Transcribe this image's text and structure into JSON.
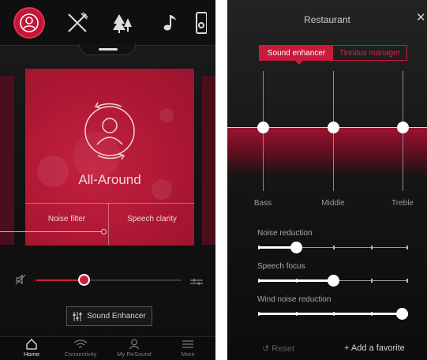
{
  "left_screen": {
    "top_bar": {
      "icons": [
        "profile-icon",
        "fork-knife-icon",
        "tree-icon",
        "music-note-icon",
        "speaker-icon"
      ],
      "accent_color": "#c4163a"
    },
    "program_card": {
      "title": "All-Around",
      "options": [
        {
          "label": "Noise filter"
        },
        {
          "label": "Speech clarity"
        }
      ]
    },
    "volume": {
      "level": 0.33
    },
    "sound_enhancer_button": {
      "label": "Sound Enhancer"
    },
    "bottom_nav": [
      {
        "label": "Home",
        "icon": "home-icon",
        "active": true
      },
      {
        "label": "Connectivity",
        "icon": "wifi-icon",
        "active": false
      },
      {
        "label": "My ReSound",
        "icon": "person-icon",
        "active": false
      },
      {
        "label": "More",
        "icon": "menu-icon",
        "active": false
      }
    ]
  },
  "right_screen": {
    "title": "Restaurant",
    "close_label": "✕",
    "tabs": [
      {
        "label": "Sound enhancer",
        "selected": true
      },
      {
        "label": "Tinnitus manager",
        "selected": false
      }
    ],
    "equalizer": [
      {
        "label": "Bass",
        "value": 0
      },
      {
        "label": "Middle",
        "value": 0
      },
      {
        "label": "Treble",
        "value": 0
      }
    ],
    "sliders": [
      {
        "label": "Noise reduction",
        "value": 0.25
      },
      {
        "label": "Speech focus",
        "value": 0.5
      },
      {
        "label": "Wind noise reduction",
        "value": 1.0
      }
    ],
    "reset_label": "Reset",
    "favorite_label": "Add a favorite",
    "accent_color": "#c91a3c"
  }
}
